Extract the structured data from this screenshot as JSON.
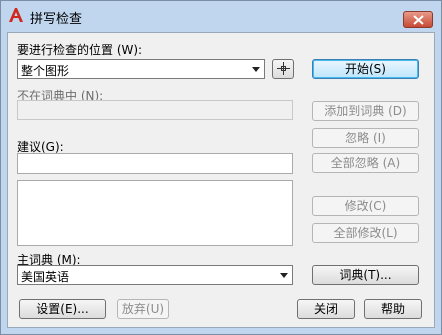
{
  "window": {
    "title": "拼写检查",
    "icon": "autocad-a-icon"
  },
  "check_where": {
    "label": "要进行检查的位置 (W):",
    "value": "整个图形"
  },
  "buttons": {
    "start": "开始(S)",
    "add_to_dictionary": "添加到词典 (D)",
    "ignore": "忽略 (I)",
    "ignore_all": "全部忽略 (A)",
    "change": "修改(C)",
    "change_all": "全部修改(L)",
    "dictionaries": "词典(T)...",
    "settings": "设置(E)...",
    "undo": "放弃(U)",
    "close": "关闭",
    "help": "帮助"
  },
  "not_in_dictionary": {
    "label": "不在词典中 (N):",
    "value": ""
  },
  "suggestions": {
    "label": "建议(G):",
    "value": "",
    "items": []
  },
  "main_dictionary": {
    "label": "主词典 (M):",
    "value": "美国英语"
  },
  "colors": {
    "window_frame": "#bfd6ee",
    "client": "#f0f0f0",
    "close_button": "#c74a33",
    "default_button": "#bee6fd"
  }
}
